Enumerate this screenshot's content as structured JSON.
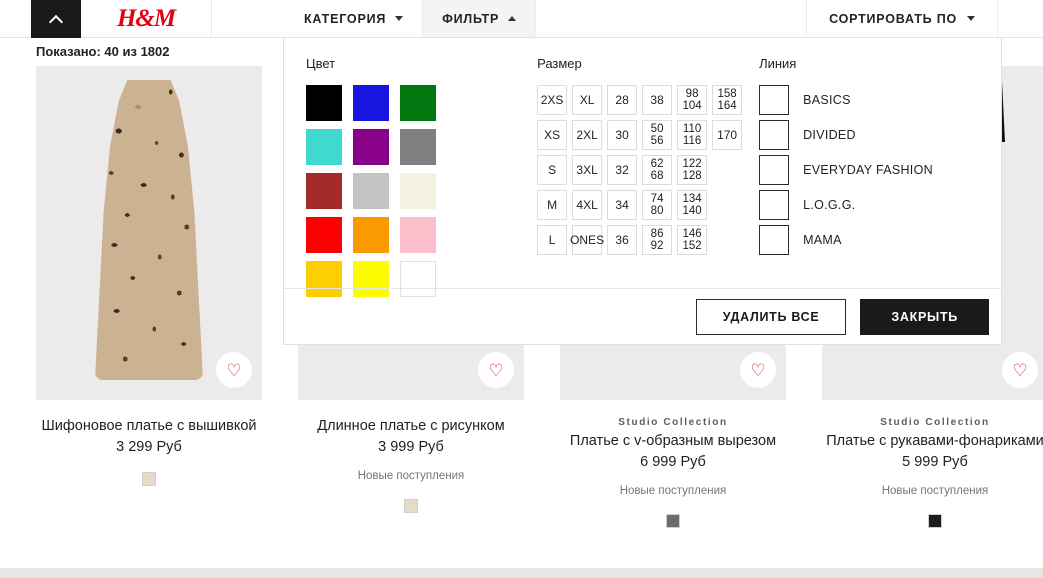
{
  "header": {
    "collapse_icon": "chevron-up-icon",
    "logo": "H&M",
    "tabs": [
      {
        "label": "КАТЕГОРИЯ",
        "icon": "chevron-down-icon",
        "active": false
      },
      {
        "label": "ФИЛЬТР",
        "icon": "chevron-up-icon",
        "active": true
      }
    ],
    "sort": {
      "label": "СОРТИРОВАТЬ ПО",
      "icon": "chevron-down-icon"
    }
  },
  "results": {
    "count_text": "Показано: 40 из 1802"
  },
  "filter_panel": {
    "color": {
      "title": "Цвет",
      "swatches": [
        {
          "name": "black",
          "hex": "#000000"
        },
        {
          "name": "blue",
          "hex": "#1616e0"
        },
        {
          "name": "green",
          "hex": "#00770f"
        },
        {
          "name": "turquoise",
          "hex": "#3fd9cd"
        },
        {
          "name": "purple",
          "hex": "#880188"
        },
        {
          "name": "gray",
          "hex": "#808080"
        },
        {
          "name": "dark-red",
          "hex": "#a32b2b"
        },
        {
          "name": "light-gray",
          "hex": "#c3c3c3"
        },
        {
          "name": "cream",
          "hex": "#f3f2e1"
        },
        {
          "name": "red",
          "hex": "#fd0000"
        },
        {
          "name": "orange",
          "hex": "#fb9900"
        },
        {
          "name": "pink",
          "hex": "#fcbecb"
        },
        {
          "name": "gold",
          "hex": "#fdce00"
        },
        {
          "name": "yellow",
          "hex": "#fcfc00"
        },
        {
          "name": "white",
          "hex": "#ffffff"
        }
      ]
    },
    "size": {
      "title": "Размер",
      "columns": [
        [
          "2XS",
          "XS",
          "S",
          "M",
          "L"
        ],
        [
          "XL",
          "2XL",
          "3XL",
          "4XL",
          "ONES"
        ],
        [
          "28",
          "30",
          "32",
          "34",
          "36"
        ],
        [
          "38",
          "50\n56",
          "62\n68",
          "74\n80",
          "86\n92"
        ],
        [
          "98\n104",
          "110\n116",
          "122\n128",
          "134\n140",
          "146\n152"
        ],
        [
          "158\n164",
          "170"
        ]
      ]
    },
    "line": {
      "title": "Линия",
      "options": [
        {
          "label": "BASICS",
          "checked": false
        },
        {
          "label": "DIVIDED",
          "checked": false
        },
        {
          "label": "EVERYDAY FASHION",
          "checked": false
        },
        {
          "label": "L.O.G.G.",
          "checked": false
        },
        {
          "label": "MAMA",
          "checked": false
        }
      ]
    },
    "actions": {
      "clear_label": "УДАЛИТЬ ВСЕ",
      "close_label": "ЗАКРЫТЬ"
    }
  },
  "products": [
    {
      "collection": "",
      "name": "Шифоновое платье с вышивкой",
      "price": "3 299 Руб",
      "new_label": "",
      "favorite_icon": "heart-icon",
      "swatches": [
        "#e6dcc6"
      ]
    },
    {
      "collection": "",
      "name": "Длинное платье с рисунком",
      "price": "3 999 Руб",
      "new_label": "Новые поступления",
      "favorite_icon": "heart-icon",
      "swatches": [
        "#e6dcc6"
      ]
    },
    {
      "collection": "Studio Collection",
      "name": "Платье с v-образным вырезом",
      "price": "6 999 Руб",
      "new_label": "Новые поступления",
      "favorite_icon": "heart-icon",
      "swatches": [
        "#6b6b70"
      ]
    },
    {
      "collection": "Studio Collection",
      "name": "Платье с рукавами-фонариками",
      "price": "5 999 Руб",
      "new_label": "Новые поступления",
      "favorite_icon": "heart-icon",
      "swatches": [
        "#1c1c1c"
      ]
    }
  ]
}
